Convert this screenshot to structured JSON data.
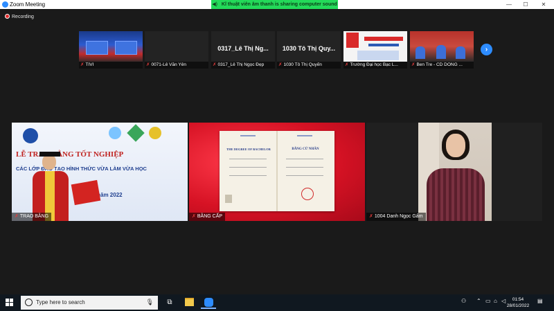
{
  "window": {
    "title": "Zoom Meeting",
    "minimize": "—",
    "maximize": "☐",
    "close": "✕"
  },
  "share_banner": {
    "text": "Kĩ thuật viên âm thanh is sharing computer sound"
  },
  "recording": {
    "label": "Recording"
  },
  "strip": {
    "tiles": [
      {
        "label": "TIVI",
        "big_name": ""
      },
      {
        "label": "0071-Lê Văn Yên",
        "big_name": ""
      },
      {
        "label": "0317_Lê Thị Ngọc Đẹp",
        "big_name": "0317_Lê Thị Ng..."
      },
      {
        "label": "1030 Tô Thị Quyến",
        "big_name": "1030 Tô Thị Quy..."
      },
      {
        "label": "Trường Đại học Bạc L...",
        "big_name": ""
      },
      {
        "label": "Ben Tre - CD DONG ...",
        "big_name": ""
      }
    ],
    "next": "›"
  },
  "main_tiles": [
    {
      "label": "TRAO BẰNG",
      "banner_line1": "LỄ TRAO BẰNG TỐT NGHIỆP",
      "banner_line2": "CÁC LỚP ĐÀO TẠO HÌNH THỨC VỪA LÀM VỪA HỌC",
      "date_text": "01 năm 2022"
    },
    {
      "label": "BẰNG CẤP",
      "doc_left": "THE DEGREE OF BACHELOR",
      "doc_right": "BẰNG CỬ NHÂN"
    },
    {
      "label": "1004 Danh Ngọc Gấm"
    }
  ],
  "taskbar": {
    "search_placeholder": "Type here to search",
    "time": "01:54",
    "date": "28/01/2022"
  },
  "colors": {
    "accent": "#2d8cff",
    "banner": "#23d959",
    "taskbar": "#101820"
  }
}
